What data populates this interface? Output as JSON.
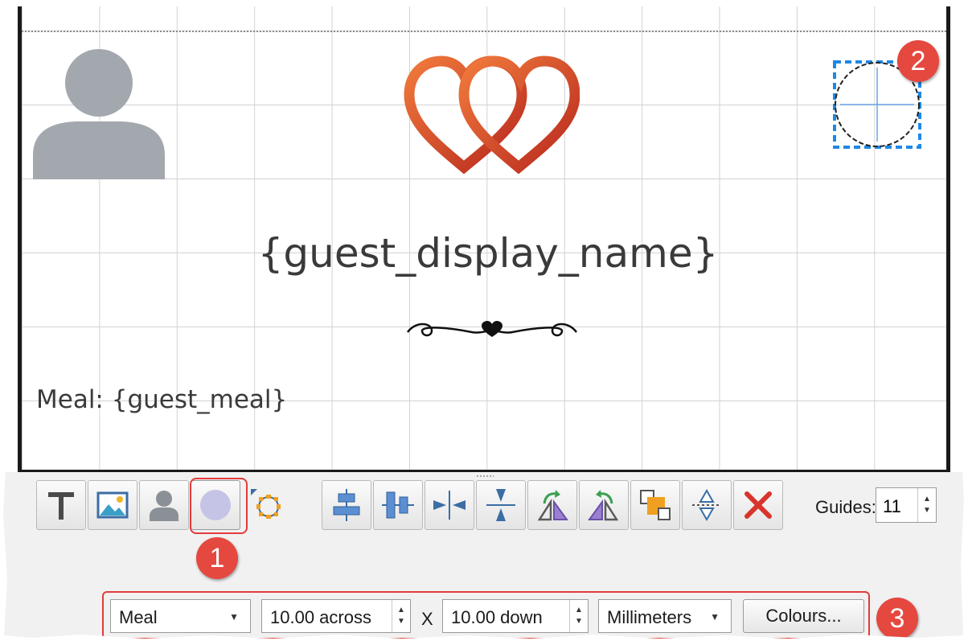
{
  "canvas": {
    "guest_name": "{guest_display_name}",
    "meal_text": "Meal: {guest_meal}"
  },
  "toolbar": {
    "tools": [
      {
        "icon": "text-tool-icon"
      },
      {
        "icon": "image-tool-icon"
      },
      {
        "icon": "guest-photo-tool-icon"
      },
      {
        "icon": "circle-shape-tool-icon"
      },
      {
        "icon": "polygon-shape-tool-icon"
      }
    ],
    "align_tools": [
      {
        "icon": "align-horizontal-center-icon"
      },
      {
        "icon": "align-vertical-center-icon"
      },
      {
        "icon": "compress-horizontal-icon"
      },
      {
        "icon": "compress-vertical-icon"
      },
      {
        "icon": "rotate-right-icon"
      },
      {
        "icon": "rotate-left-icon"
      },
      {
        "icon": "arrange-layers-icon"
      },
      {
        "icon": "flip-vertical-icon"
      },
      {
        "icon": "delete-icon"
      }
    ],
    "guides_label": "Guides:",
    "guides_value": "11"
  },
  "bottom_bar": {
    "field_select": "Meal",
    "across_value": "10.00 across",
    "x_label": "X",
    "down_value": "10.00 down",
    "units_select": "Millimeters",
    "colours_button": "Colours..."
  },
  "callouts": [
    "1",
    "2",
    "3"
  ],
  "colors": {
    "callout": "#e5483f",
    "selection": "#1e88e5",
    "heart": "#d2452a",
    "circle_tool": "#c5c3e6"
  }
}
